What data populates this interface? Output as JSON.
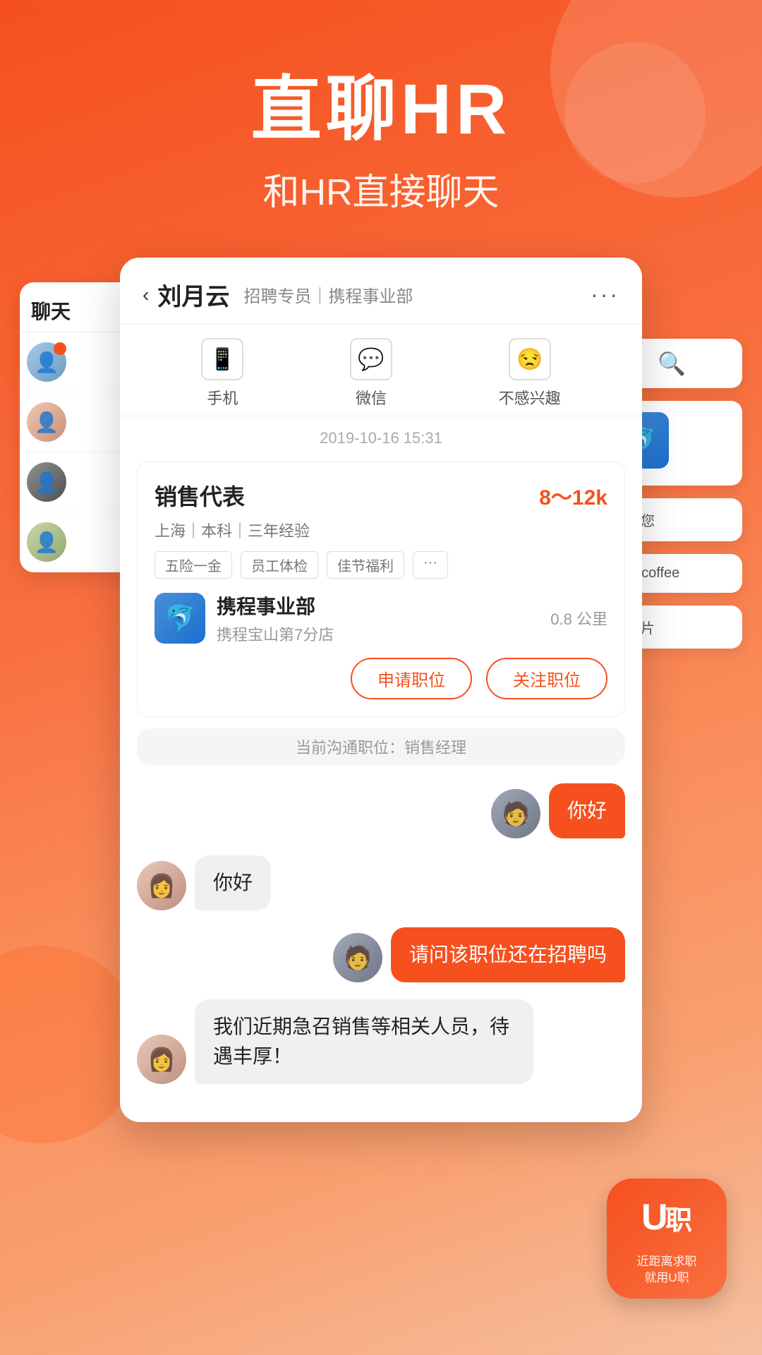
{
  "hero": {
    "title": "直聊HR",
    "subtitle": "和HR直接聊天"
  },
  "chat_header": {
    "back_label": "‹",
    "name": "刘月云",
    "role": "招聘专员｜携程事业部",
    "dots": "···"
  },
  "action_icons": [
    {
      "icon": "📱",
      "label": "手机"
    },
    {
      "icon": "💬",
      "label": "微信"
    },
    {
      "icon": "😒",
      "label": "不感兴趣"
    }
  ],
  "timestamp": "2019-10-16 15:31",
  "job": {
    "title": "销售代表",
    "salary": "8～12k",
    "meta": "上海｜本科｜三年经验",
    "tags": [
      "五险一金",
      "员工体检",
      "佳节福利",
      "···"
    ],
    "company_name": "携程事业部",
    "company_sub": "携程宝山第7分店",
    "distance": "0.8 公里",
    "btn_apply": "申请职位",
    "btn_follow": "关注职位"
  },
  "position_notice": "当前沟通职位：销售经理",
  "messages": [
    {
      "type": "sent",
      "text": "你好",
      "avatar": "user"
    },
    {
      "type": "received",
      "text": "你好",
      "avatar": "hr"
    },
    {
      "type": "sent",
      "text": "请问该职位还在招聘吗",
      "avatar": "user"
    },
    {
      "type": "received",
      "text": "我们近期急召销售等相关人员，待遇丰厚！",
      "avatar": "hr"
    }
  ],
  "bg_panel": {
    "header": "聊天",
    "items": [
      {
        "avatar": "person1",
        "hasBadge": true
      },
      {
        "avatar": "person2",
        "hasBadge": false
      },
      {
        "avatar": "person3",
        "hasBadge": false
      },
      {
        "avatar": "person4",
        "hasBadge": false
      }
    ]
  },
  "bg_right": {
    "search_icon": "🔍",
    "seen_text": "看了您",
    "coffee_text": "ckin coffee",
    "card_text": "求名片"
  },
  "app_logo": {
    "icon": "U职",
    "line1": "近距离求职",
    "line2": "就用U职"
  }
}
